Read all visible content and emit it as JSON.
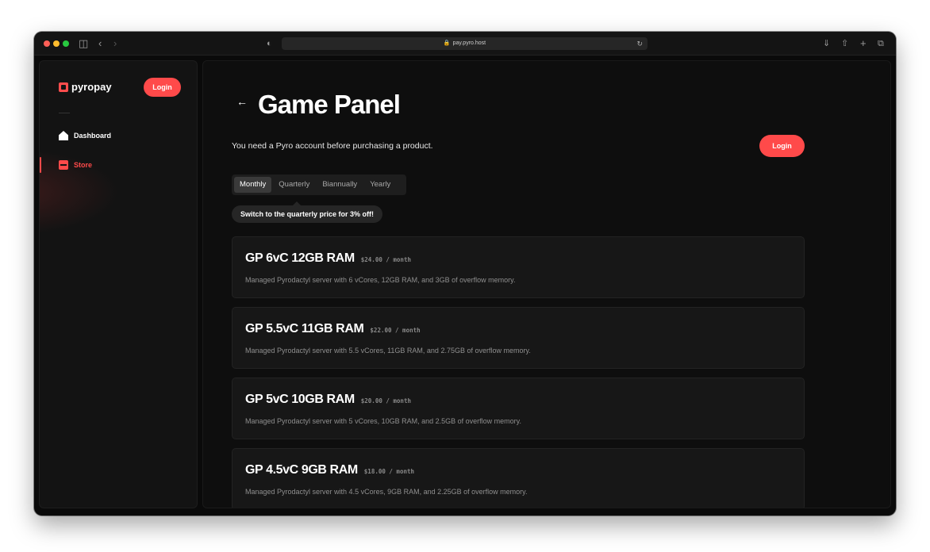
{
  "browser": {
    "url": "pay.pyro.host"
  },
  "sidebar": {
    "brand": "pyropay",
    "login_label": "Login",
    "items": [
      {
        "label": "Dashboard",
        "icon": "home-icon"
      },
      {
        "label": "Store",
        "icon": "store-icon"
      }
    ]
  },
  "main": {
    "title": "Game Panel",
    "notice": "You need a Pyro account before purchasing a product.",
    "login_label": "Login",
    "tabs": [
      {
        "label": "Monthly",
        "active": true
      },
      {
        "label": "Quarterly",
        "active": false
      },
      {
        "label": "Biannually",
        "active": false
      },
      {
        "label": "Yearly",
        "active": false
      }
    ],
    "tooltip": "Switch to the quarterly price for 3% off!",
    "products": [
      {
        "name": "GP 6vC 12GB RAM",
        "price": "$24.00 / month",
        "description": "Managed Pyrodactyl server with 6 vCores, 12GB RAM, and 3GB of overflow memory."
      },
      {
        "name": "GP 5.5vC 11GB RAM",
        "price": "$22.00 / month",
        "description": "Managed Pyrodactyl server with 5.5 vCores, 11GB RAM, and 2.75GB of overflow memory."
      },
      {
        "name": "GP 5vC 10GB RAM",
        "price": "$20.00 / month",
        "description": "Managed Pyrodactyl server with 5 vCores, 10GB RAM, and 2.5GB of overflow memory."
      },
      {
        "name": "GP 4.5vC 9GB RAM",
        "price": "$18.00 / month",
        "description": "Managed Pyrodactyl server with 4.5 vCores, 9GB RAM, and 2.25GB of overflow memory."
      }
    ]
  },
  "colors": {
    "accent": "#ff4a4a",
    "background": "#0e0e0e",
    "card": "#171717"
  }
}
